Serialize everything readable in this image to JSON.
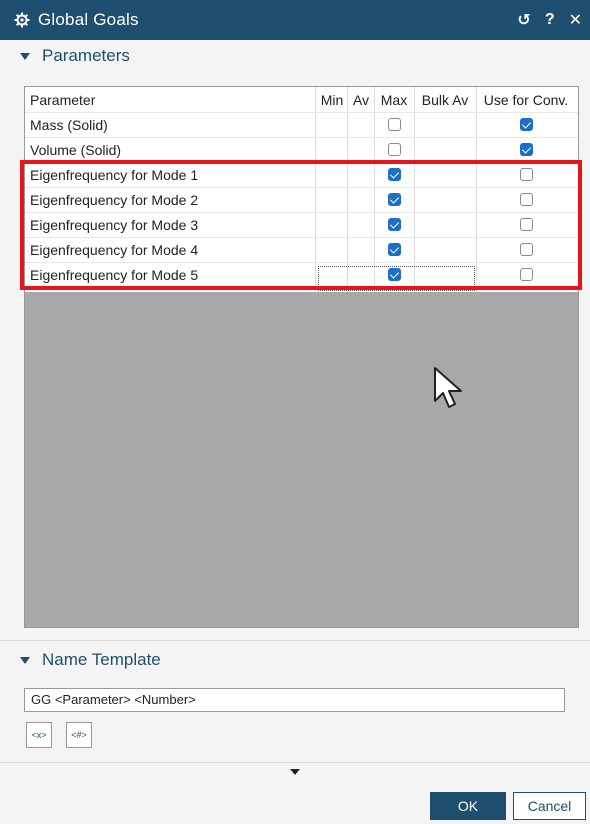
{
  "window": {
    "title": "Global Goals",
    "reset_label": "↺",
    "help_label": "?",
    "close_label": "✕"
  },
  "parameters": {
    "header": "Parameters",
    "columns": [
      "Parameter",
      "Min",
      "Av",
      "Max",
      "Bulk Av",
      "Use for Conv."
    ],
    "rows": [
      {
        "name": "Mass (Solid)",
        "max": false,
        "use_for_conv": true
      },
      {
        "name": "Volume (Solid)",
        "max": false,
        "use_for_conv": true
      },
      {
        "name": "Eigenfrequency for Mode 1",
        "max": true,
        "use_for_conv": false
      },
      {
        "name": "Eigenfrequency for Mode 2",
        "max": true,
        "use_for_conv": false
      },
      {
        "name": "Eigenfrequency for Mode 3",
        "max": true,
        "use_for_conv": false
      },
      {
        "name": "Eigenfrequency for Mode 4",
        "max": true,
        "use_for_conv": false
      },
      {
        "name": "Eigenfrequency for Mode 5",
        "max": true,
        "use_for_conv": false
      }
    ]
  },
  "name_template": {
    "header": "Name Template",
    "value": "GG <Parameter> <Number>",
    "button1_label": "<x>",
    "button2_label": "<#>"
  },
  "footer": {
    "ok_label": "OK",
    "cancel_label": "Cancel"
  },
  "colors": {
    "title_bar": "#1e4f6e",
    "highlight": "#e6141b",
    "checkbox_on": "#1b6fc6"
  }
}
